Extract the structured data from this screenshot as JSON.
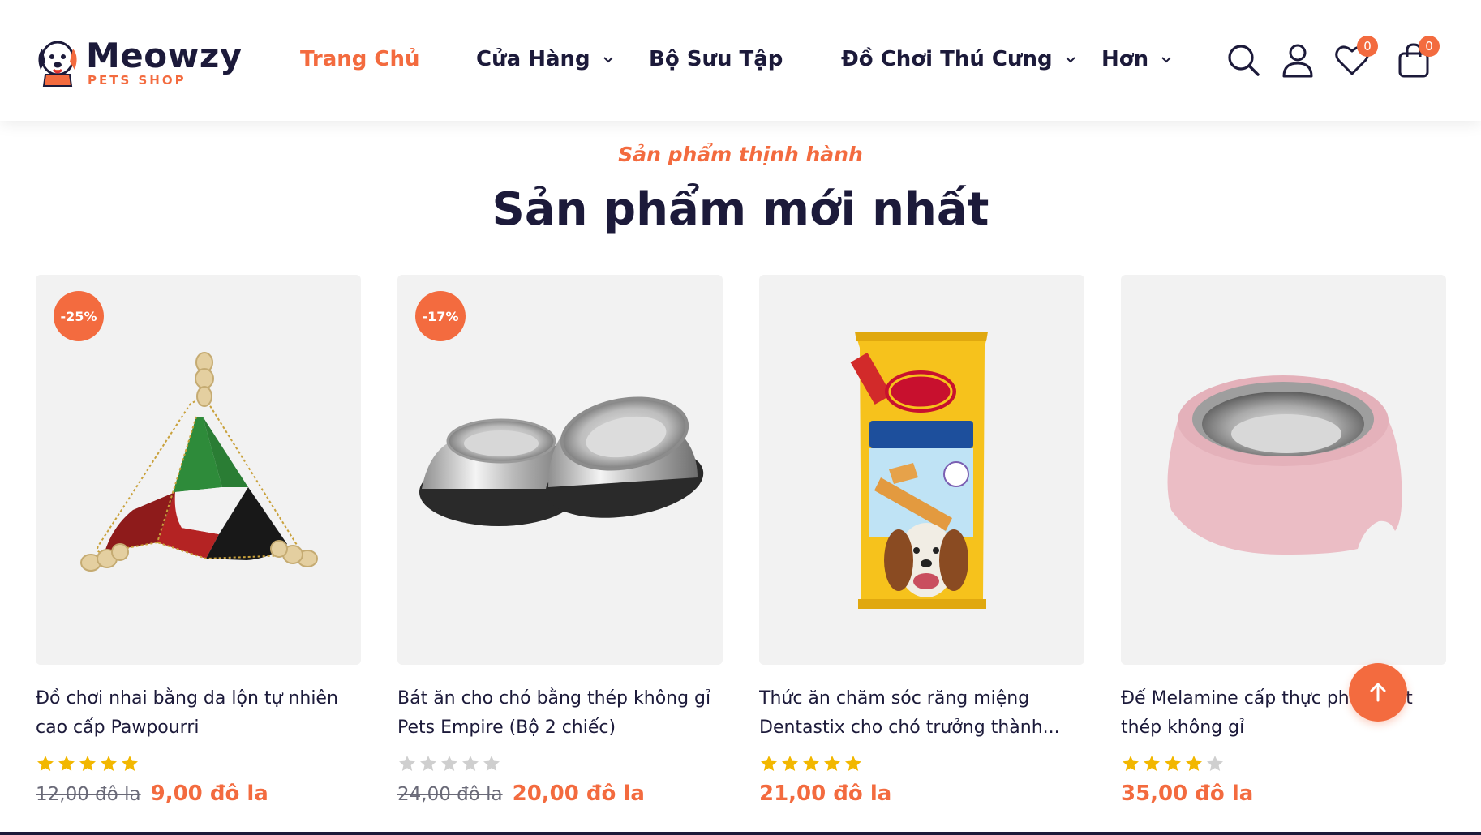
{
  "header": {
    "logo": {
      "brand": "Meowzy",
      "tagline": "PETS SHOP"
    },
    "nav": [
      {
        "label": "Trang Chủ",
        "active": true,
        "dropdown": false
      },
      {
        "label": "Cửa Hàng",
        "active": false,
        "dropdown": true
      },
      {
        "label": "Bộ Sưu Tập",
        "active": false,
        "dropdown": false
      },
      {
        "label": "Đồ Chơi Thú Cưng",
        "active": false,
        "dropdown": true
      },
      {
        "label": "Hơn",
        "active": false,
        "dropdown": true
      }
    ],
    "icons": [
      "search-icon",
      "user-icon",
      "heart-icon",
      "cart-icon"
    ],
    "wishlist_count": "0",
    "cart_count": "0"
  },
  "section": {
    "eyebrow": "Sản phẩm thịnh hành",
    "title": "Sản phẩm mới nhất"
  },
  "products": [
    {
      "name": "Đồ chơi nhai bằng da lộn tự nhiên cao cấp Pawpourri",
      "discount": "-25%",
      "rating": 5,
      "old_price": "12,00 đô la",
      "price": "9,00 đô la",
      "image": "triangle-chew-toy"
    },
    {
      "name": "Bát ăn cho chó bằng thép không gỉ Pets Empire (Bộ 2 chiếc)",
      "discount": "-17%",
      "rating": 0,
      "old_price": "24,00 đô la",
      "price": "20,00 đô la",
      "image": "steel-bowls"
    },
    {
      "name": "Thức ăn chăm sóc răng miệng Dentastix cho chó trưởng thành...",
      "discount": "",
      "rating": 5,
      "old_price": "",
      "price": "21,00 đô la",
      "image": "dentastix-pack"
    },
    {
      "name": "Đế Melamine cấp thực phẩm bát thép không gỉ",
      "discount": "",
      "rating": 4,
      "old_price": "",
      "price": "35,00 đô la",
      "image": "pink-bowl"
    }
  ],
  "colors": {
    "accent": "#f36b3f",
    "text": "#1c1a3a",
    "star": "#f2b700",
    "star_empty": "#cfcfcf",
    "card_bg": "#f2f2f2"
  },
  "back_to_top": "arrow-up-icon"
}
